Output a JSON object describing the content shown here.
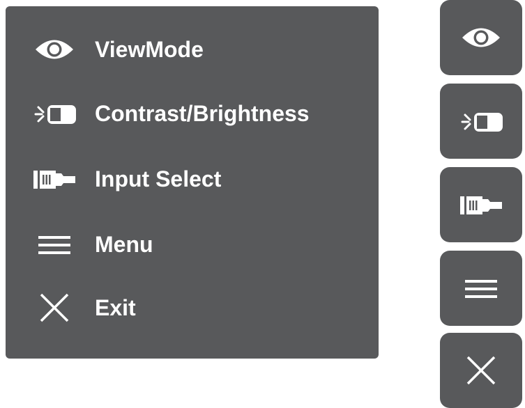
{
  "osd_menu": {
    "items": [
      {
        "label": "ViewMode",
        "icon": "eye-icon"
      },
      {
        "label": "Contrast/Brightness",
        "icon": "contrast-brightness-icon"
      },
      {
        "label": "Input Select",
        "icon": "input-plug-icon"
      },
      {
        "label": "Menu",
        "icon": "menu-icon"
      },
      {
        "label": "Exit",
        "icon": "close-icon"
      }
    ]
  },
  "quick_buttons": [
    {
      "icon": "eye-icon"
    },
    {
      "icon": "contrast-brightness-icon"
    },
    {
      "icon": "input-plug-icon"
    },
    {
      "icon": "menu-icon"
    },
    {
      "icon": "close-icon"
    }
  ],
  "colors": {
    "panel": "#58595b",
    "foreground": "#ffffff",
    "background": "#ffffff"
  }
}
